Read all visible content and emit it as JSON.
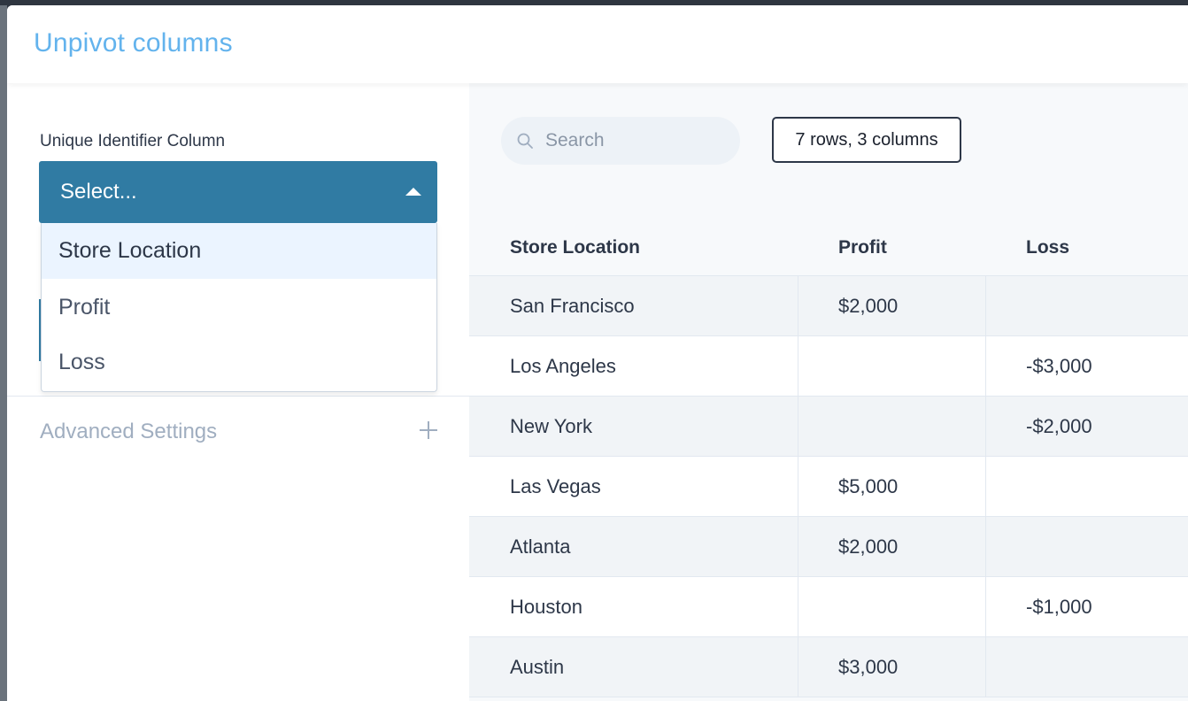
{
  "modal": {
    "title": "Unpivot columns"
  },
  "left": {
    "field_label": "Unique Identifier Column",
    "select_placeholder": "Select...",
    "dropdown_options": [
      "Store Location",
      "Profit",
      "Loss"
    ],
    "highlighted_option": "Store Location",
    "advanced_label": "Advanced Settings"
  },
  "right": {
    "search": {
      "placeholder": "Search"
    },
    "count_badge": "7 rows, 3 columns",
    "table": {
      "columns": [
        "Store Location",
        "Profit",
        "Loss"
      ],
      "rows": [
        [
          "San Francisco",
          "$2,000",
          ""
        ],
        [
          "Los Angeles",
          "",
          "-$3,000"
        ],
        [
          "New York",
          "",
          "-$2,000"
        ],
        [
          "Las Vegas",
          "$5,000",
          ""
        ],
        [
          "Atlanta",
          "$2,000",
          ""
        ],
        [
          "Houston",
          "",
          "-$1,000"
        ],
        [
          "Austin",
          "$3,000",
          ""
        ]
      ]
    }
  },
  "icons": {
    "search": "search-icon",
    "caret": "caret-up-icon",
    "expand": "plus-icon"
  },
  "colors": {
    "title": "#63b3ed",
    "select_bg": "#307ba3",
    "option_highlight": "#ebf4ff"
  }
}
